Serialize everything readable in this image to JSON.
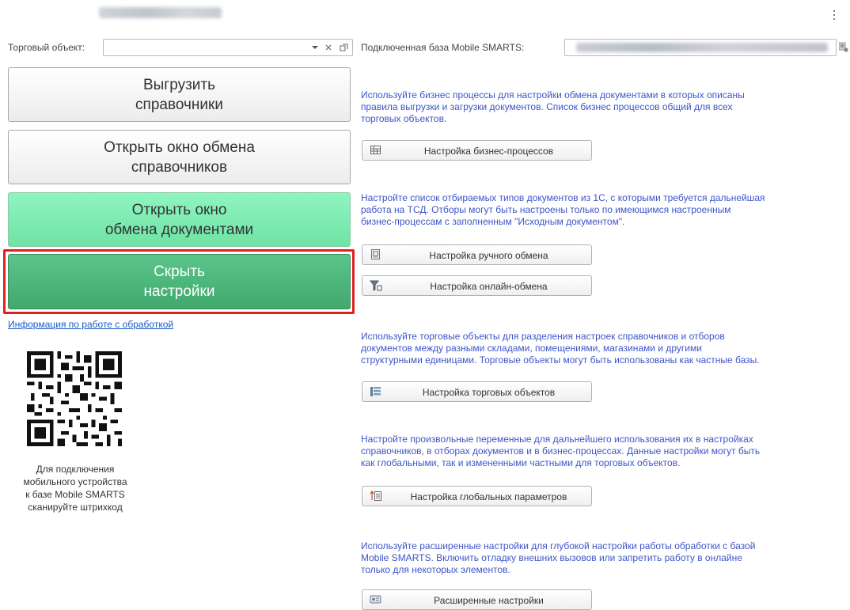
{
  "header": {},
  "trade_object": {
    "label": "Торговый объект:",
    "value": ""
  },
  "connected_db": {
    "label": "Подключенная база Mobile SMARTS:"
  },
  "left_buttons": {
    "upload": [
      "Выгрузить",
      "справочники"
    ],
    "open_catalog_exchange": [
      "Открыть окно обмена",
      "справочников"
    ],
    "open_document_exchange": [
      "Открыть окно",
      "обмена документами"
    ],
    "hide_settings": [
      "Скрыть",
      "настройки"
    ]
  },
  "info_link": "Информация по работе с обработкой",
  "qr_caption": [
    "Для подключения",
    "мобильного устройства",
    "к базе Mobile SMARTS",
    "сканируйте штрихкод"
  ],
  "sections": [
    {
      "text": [
        "Используйте бизнес процессы для настройки обмена документами в которых описаны",
        "правила выгрузки и загрузки документов. Список бизнес процессов общий для всех",
        "торговых объектов."
      ],
      "buttons": [
        {
          "label": "Настройка бизнес-процессов",
          "icon": "table-icon"
        }
      ]
    },
    {
      "text": [
        "Настройте список отбираемых типов документов из 1С, с которыми требуется дальнейшая",
        "работа на ТСД. Отборы могут быть настроены только по имеющимся настроенным",
        "бизнес-процессам с заполненным \"Исходным документом\"."
      ],
      "buttons": [
        {
          "label": "Настройка ручного обмена",
          "icon": "document-icon"
        },
        {
          "label": "Настройка онлайн-обмена",
          "icon": "filter-icon"
        }
      ]
    },
    {
      "text": [
        "Используйте торговые объекты для разделения настроек справочников и отборов",
        "документов между разными складами, помещениями, магазинами и другими",
        "структурными единицами. Торговые объекты могут быть использованы как частные базы."
      ],
      "buttons": [
        {
          "label": "Настройка торговых объектов",
          "icon": "hierarchy-icon"
        }
      ]
    },
    {
      "text": [
        "Настройте произвольные переменные для дальнейшего использования их в настройках",
        "справочников, в отборах документов и в бизнес-процессах. Данные настройки могут быть",
        "как глобальными, так и измененными частными для торговых объектов."
      ],
      "buttons": [
        {
          "label": "Настройка глобальных параметров",
          "icon": "parameters-icon"
        }
      ]
    },
    {
      "text": [
        "Используйте расширенные настройки для глубокой настройки работы обработки с базой",
        "Mobile SMARTS. Включить отладку внешних вызовов или запретить работу в онлайне",
        "только для некоторых элементов."
      ],
      "buttons": [
        {
          "label": "Расширенные настройки",
          "icon": "advanced-settings-icon"
        }
      ]
    }
  ],
  "colors": {
    "link": "#1a5bc4",
    "description": "#3d55c9",
    "highlight": "#e02020",
    "green_light": "#7ff0b4",
    "green_dark": "#4db77c"
  }
}
